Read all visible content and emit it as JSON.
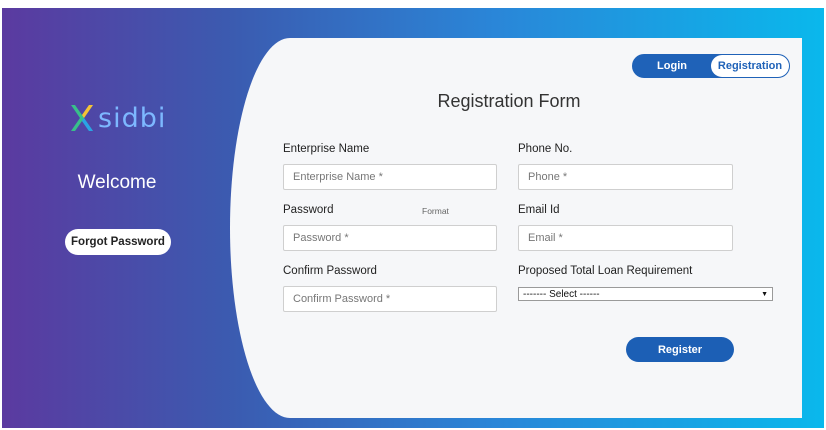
{
  "brand": {
    "logo_text": "sidbi",
    "welcome": "Welcome",
    "forgot_password": "Forgot Password"
  },
  "tabs": {
    "login": "Login",
    "registration": "Registration",
    "active": "Registration"
  },
  "form": {
    "title": "Registration Form",
    "enterprise_name": {
      "label": "Enterprise Name",
      "placeholder": "Enterprise Name *",
      "value": ""
    },
    "phone": {
      "label": "Phone No.",
      "placeholder": "Phone *",
      "value": ""
    },
    "password": {
      "label": "Password",
      "hint": "Format",
      "placeholder": "Password *",
      "value": ""
    },
    "email": {
      "label": "Email Id",
      "placeholder": "Email *",
      "value": ""
    },
    "confirm_password": {
      "label": "Confirm Password",
      "placeholder": "Confirm Password *",
      "value": ""
    },
    "loan": {
      "label": "Proposed Total Loan Requirement",
      "selected": "------- Select ------"
    },
    "register": "Register"
  },
  "colors": {
    "gradient_start": "#5b3aa0",
    "gradient_end": "#0ab8ec",
    "accent": "#1c5fb5"
  }
}
